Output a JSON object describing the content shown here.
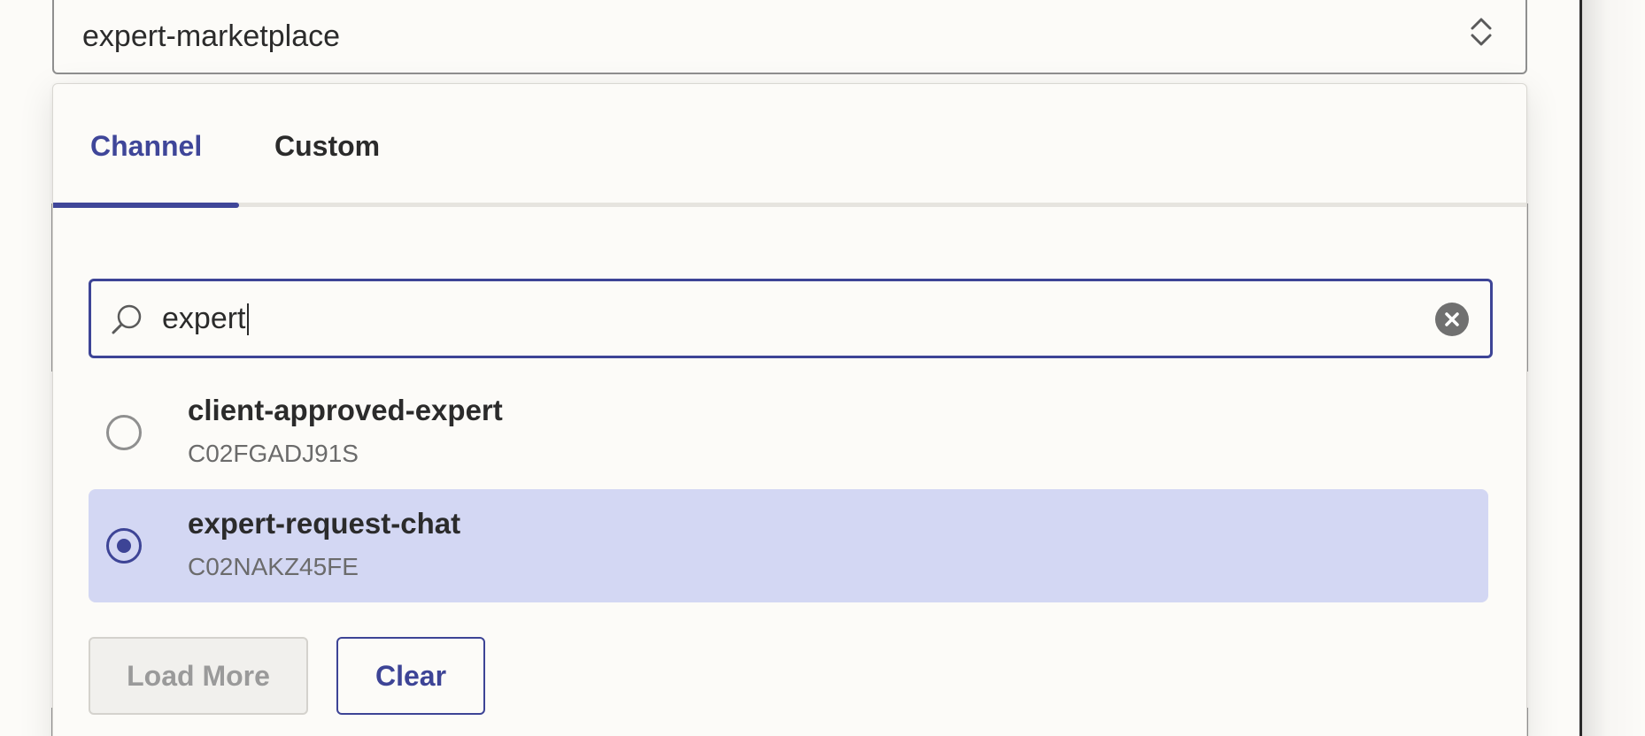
{
  "select": {
    "value": "expert-marketplace",
    "icon": "chevron-up-down-icon"
  },
  "tabs": [
    {
      "label": "Channel",
      "active": true
    },
    {
      "label": "Custom",
      "active": false
    }
  ],
  "search": {
    "value": "expert",
    "icon": "search-icon",
    "clear_icon": "clear-x-icon"
  },
  "options": [
    {
      "label": "client-approved-expert",
      "id": "C02FGADJ91S",
      "selected": false
    },
    {
      "label": "expert-request-chat",
      "id": "C02NAKZ45FE",
      "selected": true
    }
  ],
  "buttons": {
    "load_more": "Load More",
    "clear": "Clear"
  },
  "colors": {
    "accent": "#3d4496",
    "selected_row": "#d3d7f3",
    "background": "#fcfbf8"
  }
}
